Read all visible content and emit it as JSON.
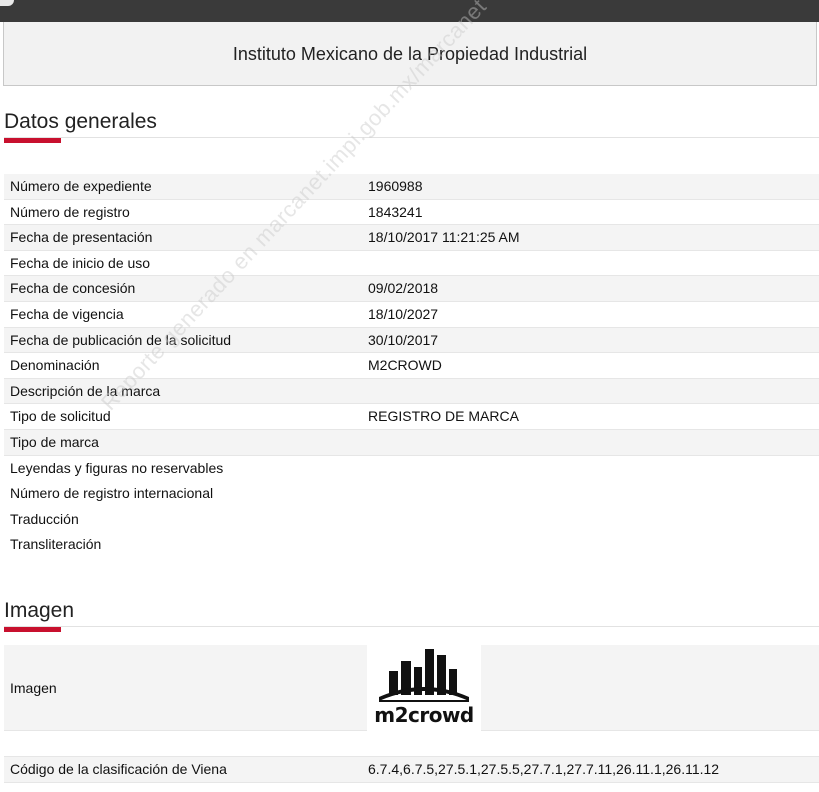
{
  "header": {
    "institution": "Instituto Mexicano de la Propiedad Industrial"
  },
  "general": {
    "section_title": "Datos generales",
    "rows": [
      {
        "label": "Número de expediente",
        "value": "1960988"
      },
      {
        "label": "Número de registro",
        "value": "1843241"
      },
      {
        "label": "Fecha de presentación",
        "value": "18/10/2017 11:21:25 AM"
      },
      {
        "label": "Fecha de inicio de uso",
        "value": ""
      },
      {
        "label": "Fecha de concesión",
        "value": "09/02/2018"
      },
      {
        "label": "Fecha de vigencia",
        "value": "18/10/2027"
      },
      {
        "label": "Fecha de publicación de la solicitud",
        "value": "30/10/2017"
      },
      {
        "label": "Denominación",
        "value": "M2CROWD"
      },
      {
        "label": "Descripción de la marca",
        "value": ""
      },
      {
        "label": "Tipo de solicitud",
        "value": "REGISTRO DE MARCA"
      },
      {
        "label": "Tipo de marca",
        "value": ""
      },
      {
        "label": "Leyendas y figuras no reservables",
        "value": ""
      },
      {
        "label": "Número de registro internacional",
        "value": ""
      },
      {
        "label": "Traducción",
        "value": ""
      },
      {
        "label": "Transliteración",
        "value": ""
      }
    ]
  },
  "image_section": {
    "section_title": "Imagen",
    "image_label": "Imagen",
    "logo_text": "m2crowd",
    "viena_label": "Código de la clasificación de Viena",
    "viena_value": "6.7.4,6.7.5,27.5.1,27.5.5,27.7.1,27.7.11,26.11.1,26.11.12"
  },
  "watermark": "Reporte generado en marcanet.impi.gob.mx/marcanet",
  "colors": {
    "accent": "#c8102e",
    "topbar": "#3a3a3a",
    "row_shade": "#f4f4f4"
  }
}
